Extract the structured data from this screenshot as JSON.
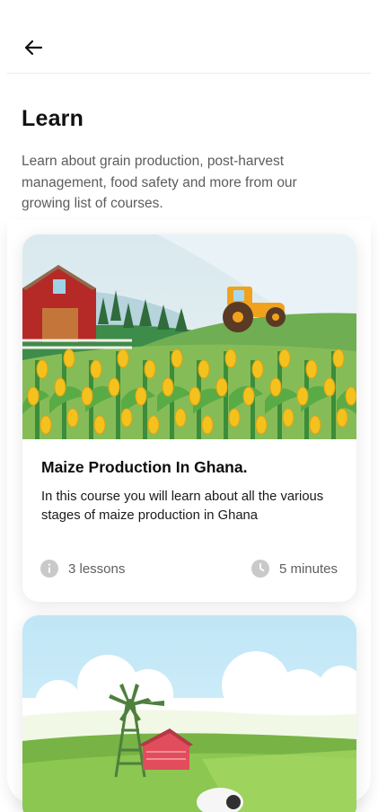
{
  "header": {
    "back_icon": "arrow-left-icon"
  },
  "page": {
    "title": "Learn",
    "intro": "Learn about grain production, post-harvest management, food safety and more from our growing list of courses."
  },
  "courses": [
    {
      "title": "Maize Production In Ghana.",
      "description": "In this course you will learn about all the various stages of maize production in Ghana",
      "lessons": "3 lessons",
      "duration": "5 minutes",
      "lessons_icon": "info-icon",
      "duration_icon": "clock-icon",
      "illustration": "farm-barn-tractor-maize-illustration"
    },
    {
      "illustration": "windmill-farm-illustration"
    }
  ],
  "colors": {
    "background": "#ffffff",
    "title": "#111111",
    "body_text": "#5c5c5c",
    "meta_icon": "#c9c9c9",
    "divider": "#ececec"
  }
}
